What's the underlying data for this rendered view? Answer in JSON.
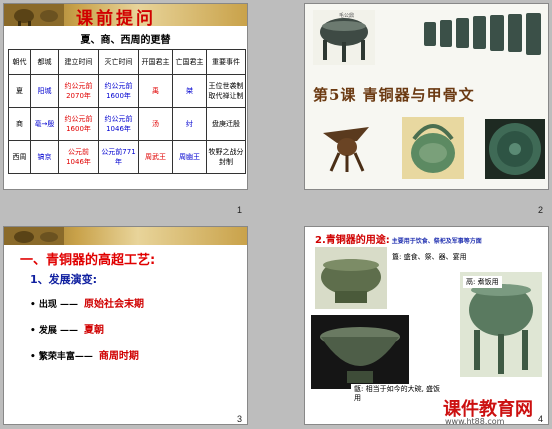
{
  "slide1": {
    "banner_title": "课前提问",
    "subtitle": "夏、商、西周的更替",
    "headers": [
      "朝代",
      "都城",
      "建立时间",
      "灭亡时间",
      "开国君主",
      "亡国君主",
      "重要事件"
    ],
    "rows": [
      {
        "dynasty": "夏",
        "capital": "阳城",
        "founded": "约公元前2070年",
        "fell": "约公元前1600年",
        "first": "禹",
        "last": "桀",
        "event": "王位世袭制取代禅让制"
      },
      {
        "dynasty": "商",
        "capital": "亳→殷",
        "founded": "约公元前1600年",
        "fell": "约公元前1046年",
        "first": "汤",
        "last": "纣",
        "event": "盘庚迁殷"
      },
      {
        "dynasty": "西周",
        "capital": "镐京",
        "founded": "公元前1046年",
        "fell": "公元前771年",
        "first": "周武王",
        "last": "周幽王",
        "event": "牧野之战分封制"
      }
    ],
    "page_number": "1"
  },
  "slide2": {
    "title": "第5课 青铜器与甲骨文",
    "small_caption": "毛公鼎",
    "page_number": "2"
  },
  "slide3": {
    "heading": "一、青铜器的高超工艺:",
    "subheading": "1、发展演变:",
    "rows": [
      {
        "label": "• 出现 ——",
        "value": "原始社会末期"
      },
      {
        "label": "• 发展 ——",
        "value": "夏朝"
      },
      {
        "label": "• 繁荣丰富——",
        "value": "商周时期"
      }
    ],
    "page_number": "3"
  },
  "slide4": {
    "title": "2.青铜器的用途:",
    "title_small": "主要用于饮食、祭祀及军事等方面",
    "label_gui": "簋: 盛食、祭、器、宴用",
    "label_li": "鬲: 煮饭用",
    "label_bottom": "甑: 相当于如今的大碗, 盛饭用",
    "page_number": "4"
  },
  "watermark": {
    "brand": "课件教育网",
    "url": "www.ht88.com"
  },
  "colors": {
    "accent_red": "#e00000",
    "accent_blue": "#0000d0",
    "banner_gold": "#c9a24a",
    "bronze": "#5d7060"
  }
}
